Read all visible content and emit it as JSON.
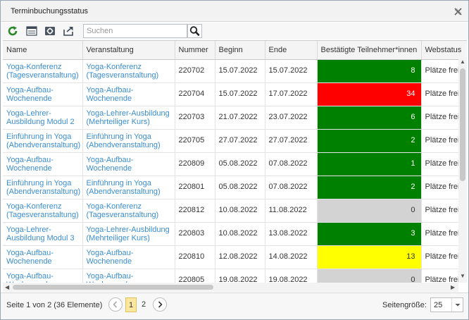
{
  "window": {
    "title": "Terminbuchungsstatus"
  },
  "toolbar": {
    "search_placeholder": "Suchen"
  },
  "table": {
    "columns": [
      "Name",
      "Veranstaltung",
      "Nummer",
      "Beginn",
      "Ende",
      "Bestätigte Teilnehmer*innen",
      "Webstatus"
    ],
    "rows": [
      {
        "name": "Yoga-Konferenz (Tagesveranstaltung)",
        "event": "Yoga-Konferenz (Tagesveranstaltung)",
        "number": "220702",
        "start": "15.07.2022",
        "end": "15.07.2022",
        "confirmed": "8",
        "status_color": "#008000",
        "webstatus": "Plätze frei"
      },
      {
        "name": "Yoga-Aufbau-Wochenende",
        "event": "Yoga-Aufbau-Wochenende",
        "number": "220704",
        "start": "15.07.2022",
        "end": "17.07.2022",
        "confirmed": "34",
        "status_color": "#ff0000",
        "webstatus": "Plätze frei"
      },
      {
        "name": "Yoga-Lehrer-Ausbildung Modul 2",
        "event": "Yoga-Lehrer-Ausbildung (Mehrteiliger Kurs)",
        "number": "220703",
        "start": "21.07.2022",
        "end": "23.07.2022",
        "confirmed": "6",
        "status_color": "#008000",
        "webstatus": "Plätze frei"
      },
      {
        "name": "Einführung in Yoga (Abendveranstaltung)",
        "event": "Einführung in Yoga (Abendveranstaltung)",
        "number": "220705",
        "start": "27.07.2022",
        "end": "27.07.2022",
        "confirmed": "2",
        "status_color": "#008000",
        "webstatus": "Plätze frei"
      },
      {
        "name": "Yoga-Aufbau-Wochenende",
        "event": "Yoga-Aufbau-Wochenende",
        "number": "220809",
        "start": "05.08.2022",
        "end": "07.08.2022",
        "confirmed": "1",
        "status_color": "#008000",
        "webstatus": "Plätze frei"
      },
      {
        "name": "Einführung in Yoga (Abendveranstaltung)",
        "event": "Einführung in Yoga (Abendveranstaltung)",
        "number": "220801",
        "start": "05.08.2022",
        "end": "07.08.2022",
        "confirmed": "2",
        "status_color": "#008000",
        "webstatus": "Plätze frei"
      },
      {
        "name": "Yoga-Konferenz (Tagesveranstaltung)",
        "event": "Yoga-Konferenz (Tagesveranstaltung)",
        "number": "220812",
        "start": "10.08.2022",
        "end": "11.08.2022",
        "confirmed": "0",
        "status_color": "#d3d3d3",
        "webstatus": "Plätze frei"
      },
      {
        "name": "Yoga-Lehrer-Ausbildung Modul 3",
        "event": "Yoga-Lehrer-Ausbildung (Mehrteiliger Kurs)",
        "number": "220803",
        "start": "10.08.2022",
        "end": "13.08.2022",
        "confirmed": "3",
        "status_color": "#008000",
        "webstatus": "Plätze frei"
      },
      {
        "name": "Yoga-Aufbau-Wochenende",
        "event": "Yoga-Aufbau-Wochenende",
        "number": "220810",
        "start": "12.08.2022",
        "end": "14.08.2022",
        "confirmed": "13",
        "status_color": "#ffff00",
        "webstatus": "Plätze frei"
      },
      {
        "name": "Yoga-Aufbau-Wochenende",
        "event": "Yoga-Aufbau-Wochenende",
        "number": "220805",
        "start": "19.08.2022",
        "end": "19.08.2022",
        "confirmed": "0",
        "status_color": "#d3d3d3",
        "webstatus": "Plätze frei"
      }
    ]
  },
  "pager": {
    "info": "Seite 1 von 2 (36 Elemente)",
    "pages": [
      "1",
      "2"
    ],
    "current_page": "1",
    "size_label": "Seitengröße:",
    "size_value": "25"
  },
  "icons": {
    "refresh": "refresh-icon",
    "columns": "column-chooser-icon",
    "settings": "settings-icon",
    "export": "export-icon",
    "search": "search-icon",
    "close": "close-icon"
  }
}
